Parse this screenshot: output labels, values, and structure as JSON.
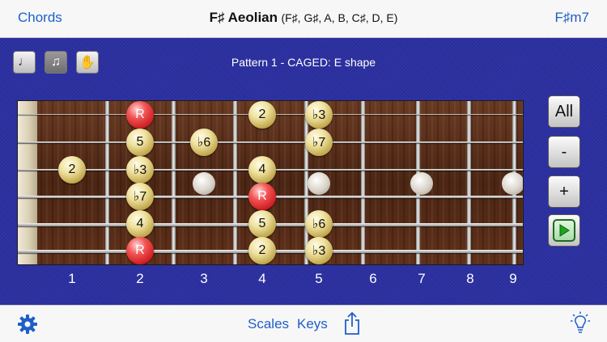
{
  "header": {
    "left_label": "Chords",
    "title_name": "F♯ Aeolian",
    "title_notes": "(F♯, G♯, A, B, C♯, D, E)",
    "right_label": "F♯m7"
  },
  "toolbar": {
    "modes": [
      {
        "icon": "quarter-note-icon",
        "glyph": "♩",
        "active": false
      },
      {
        "icon": "eighth-notes-icon",
        "glyph": "♫",
        "active": true
      },
      {
        "icon": "hand-icon",
        "glyph": "✋",
        "active": false
      }
    ],
    "pattern_label": "Pattern 1 - CAGED: E shape"
  },
  "fretboard": {
    "fret_numbers": [
      "1",
      "2",
      "3",
      "4",
      "5",
      "6",
      "7",
      "8",
      "9"
    ],
    "inlay_frets": [
      3,
      5,
      7,
      9
    ],
    "notes": [
      {
        "string": 1,
        "fret": 2,
        "label": "R",
        "root": true
      },
      {
        "string": 1,
        "fret": 4,
        "label": "2",
        "root": false
      },
      {
        "string": 1,
        "fret": 5,
        "label": "♭3",
        "root": false
      },
      {
        "string": 2,
        "fret": 2,
        "label": "5",
        "root": false
      },
      {
        "string": 2,
        "fret": 3,
        "label": "♭6",
        "root": false
      },
      {
        "string": 2,
        "fret": 5,
        "label": "♭7",
        "root": false
      },
      {
        "string": 3,
        "fret": 1,
        "label": "2",
        "root": false
      },
      {
        "string": 3,
        "fret": 2,
        "label": "♭3",
        "root": false
      },
      {
        "string": 3,
        "fret": 4,
        "label": "4",
        "root": false
      },
      {
        "string": 4,
        "fret": 2,
        "label": "♭7",
        "root": false
      },
      {
        "string": 4,
        "fret": 4,
        "label": "R",
        "root": true
      },
      {
        "string": 5,
        "fret": 2,
        "label": "4",
        "root": false
      },
      {
        "string": 5,
        "fret": 4,
        "label": "5",
        "root": false
      },
      {
        "string": 5,
        "fret": 5,
        "label": "♭6",
        "root": false
      },
      {
        "string": 6,
        "fret": 2,
        "label": "R",
        "root": true
      },
      {
        "string": 6,
        "fret": 4,
        "label": "2",
        "root": false
      },
      {
        "string": 6,
        "fret": 5,
        "label": "♭3",
        "root": false
      }
    ]
  },
  "side_buttons": {
    "all_label": "All",
    "minus_label": "-",
    "plus_label": "+",
    "loop_icon": "play-loop-icon"
  },
  "footer": {
    "settings_icon": "gear-icon",
    "scales_label": "Scales",
    "keys_label": "Keys",
    "share_icon": "share-icon",
    "tips_icon": "lightbulb-icon"
  },
  "colors": {
    "accent": "#1e5fc9",
    "background": "#2b2fa0",
    "root_note": "#d31b22",
    "scale_note": "#e9d98f"
  }
}
